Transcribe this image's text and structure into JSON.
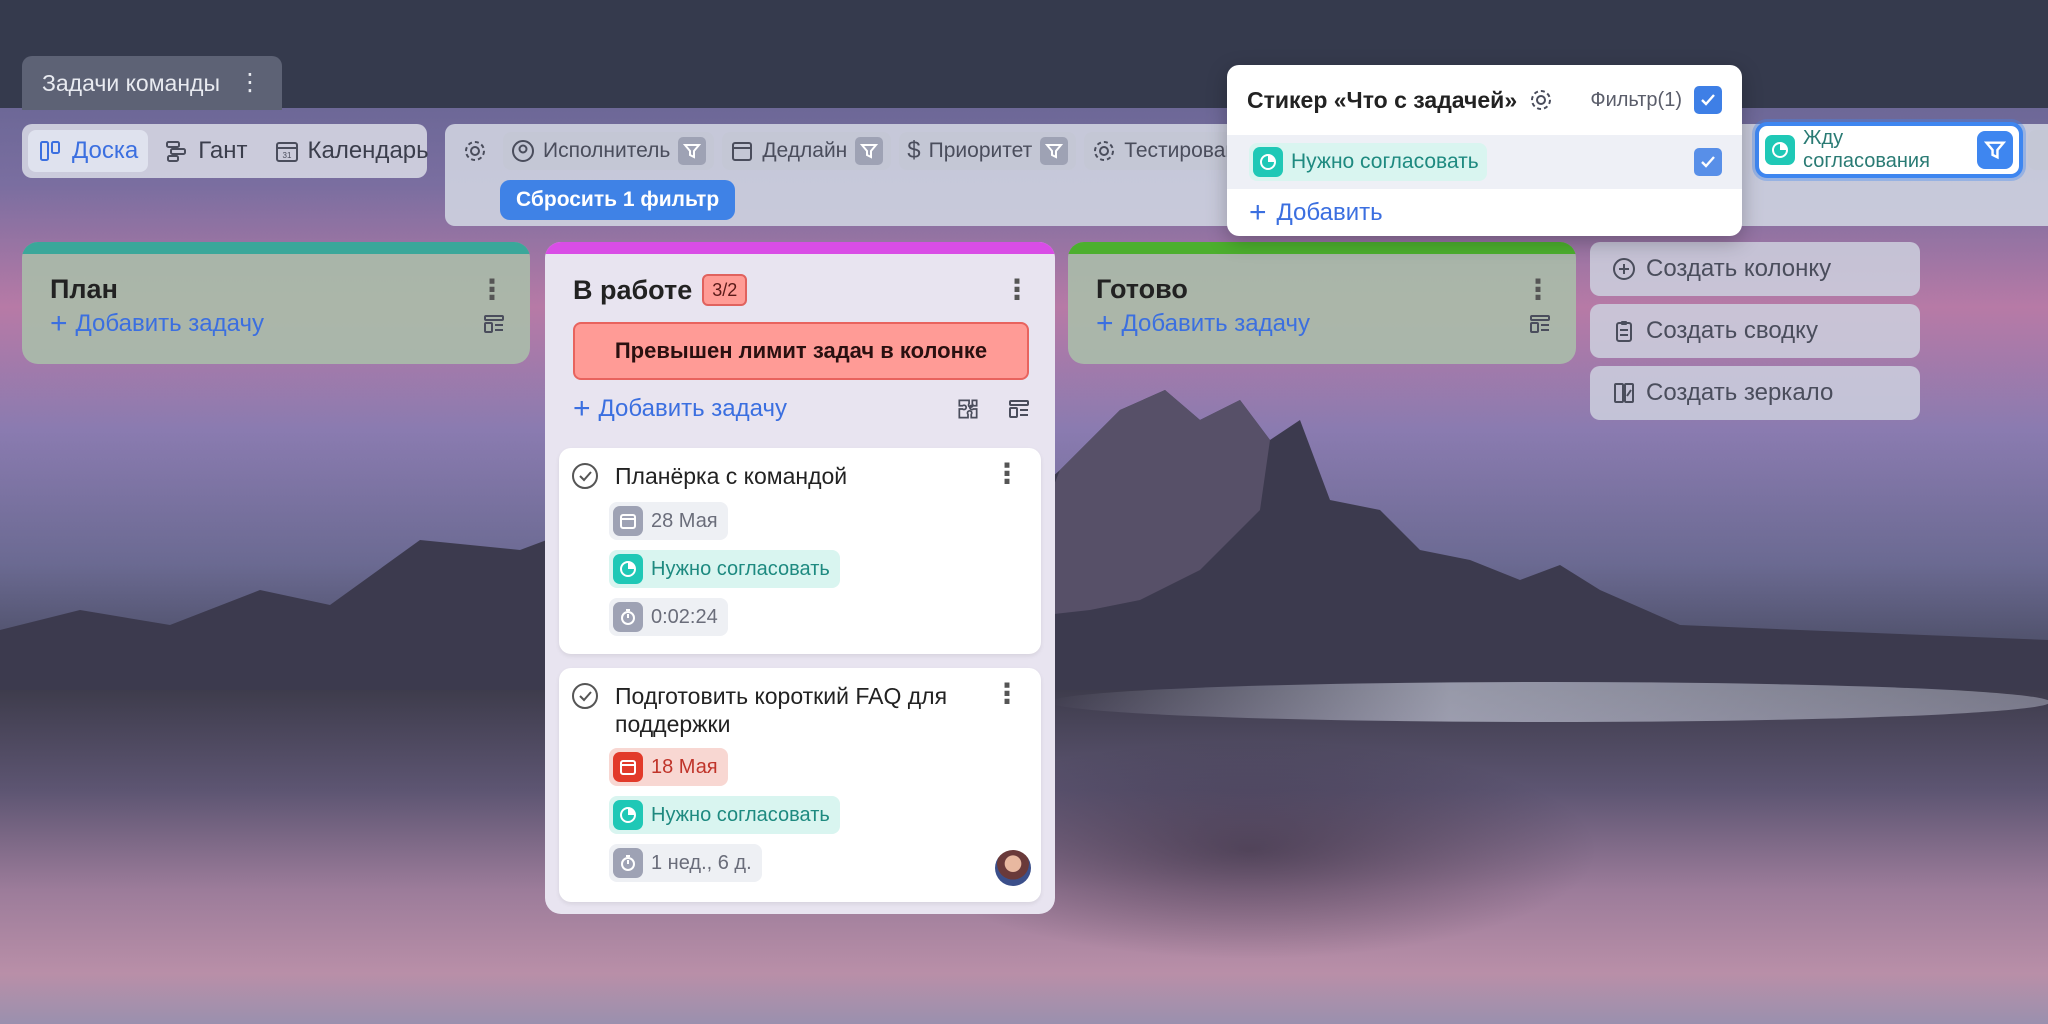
{
  "board": {
    "tab_label": "Задачи команды"
  },
  "views": [
    {
      "label": "Доска",
      "icon": "board-icon",
      "active": true
    },
    {
      "label": "Гант",
      "icon": "gantt-icon",
      "active": false
    },
    {
      "label": "Календарь",
      "icon": "calendar-icon",
      "active": false
    }
  ],
  "filters": {
    "items": [
      {
        "label": "Исполнитель",
        "icon": "user-icon"
      },
      {
        "label": "Дедлайн",
        "icon": "calendar-icon"
      },
      {
        "label": "Приоритет",
        "icon": "dollar-icon"
      },
      {
        "label": "Тестировани",
        "icon": "gear-icon"
      }
    ],
    "reset_label": "Сбросить 1 фильтр",
    "active_sticker_label": "Жду согласования"
  },
  "popup": {
    "title": "Стикер «Что с задачей»",
    "filter_label": "Фильтр(1)",
    "option_label": "Нужно согласовать",
    "add_label": "Добавить"
  },
  "columns": [
    {
      "title": "План",
      "add_label": "Добавить задачу",
      "color": "#3aa79a"
    },
    {
      "title": "В работе",
      "limit": "3/2",
      "warning": "Превышен лимит задач в колонке",
      "add_label": "Добавить задачу",
      "color": "#d94de6"
    },
    {
      "title": "Готово",
      "add_label": "Добавить задачу",
      "color": "#4caf2e"
    }
  ],
  "cards": [
    {
      "title": "Планёрка с командой",
      "date": "28 Мая",
      "sticker": "Нужно согласовать",
      "timer": "0:02:24"
    },
    {
      "title": "Подготовить короткий FAQ для поддержки",
      "date": "18 Мая",
      "sticker": "Нужно согласовать",
      "timer": "1 нед., 6 д."
    }
  ],
  "side_actions": [
    {
      "label": "Создать колонку",
      "icon": "plus-circle-icon"
    },
    {
      "label": "Создать сводку",
      "icon": "clipboard-icon"
    },
    {
      "label": "Создать зеркало",
      "icon": "mirror-icon"
    }
  ]
}
